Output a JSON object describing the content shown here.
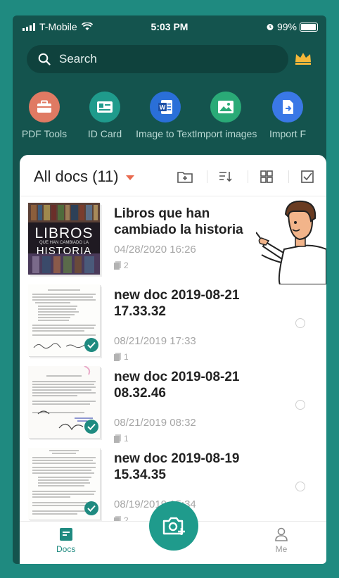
{
  "status": {
    "carrier": "T-Mobile",
    "time": "5:03 PM",
    "battery": "99%"
  },
  "search": {
    "placeholder": "Search"
  },
  "tools": [
    {
      "label": "PDF Tools",
      "icon": "toolbox-icon",
      "color": "#e07a63"
    },
    {
      "label": "ID Card",
      "icon": "id-card-icon",
      "color": "#1f9b8c"
    },
    {
      "label": "Image to Text",
      "icon": "word-icon",
      "color": "#2a6fd8"
    },
    {
      "label": "Import images",
      "icon": "image-icon",
      "color": "#2aaa77"
    },
    {
      "label": "Import F",
      "icon": "import-file-icon",
      "color": "#3a78e6"
    }
  ],
  "docs_panel": {
    "title": "All docs (11)"
  },
  "documents": [
    {
      "name": "Libros que han cambiado la historia",
      "date": "04/28/2020 16:26",
      "pages": "2",
      "thumb_text": "LIBROS",
      "thumb_sub": "QUE HAN CAMBIADO LA",
      "thumb_text2": "HISTORIA"
    },
    {
      "name": "new doc 2019-08-21 17.33.32",
      "date": "08/21/2019 17:33",
      "pages": "1"
    },
    {
      "name": "new doc 2019-08-21 08.32.46",
      "date": "08/21/2019 08:32",
      "pages": "1"
    },
    {
      "name": "new doc 2019-08-19 15.34.35",
      "date": "08/19/2019 15:34",
      "pages": "2"
    }
  ],
  "tabs": {
    "docs": "Docs",
    "me": "Me"
  },
  "colors": {
    "brand": "#1f8a80",
    "accent": "#e96a4f",
    "crown": "#f5b83a"
  }
}
